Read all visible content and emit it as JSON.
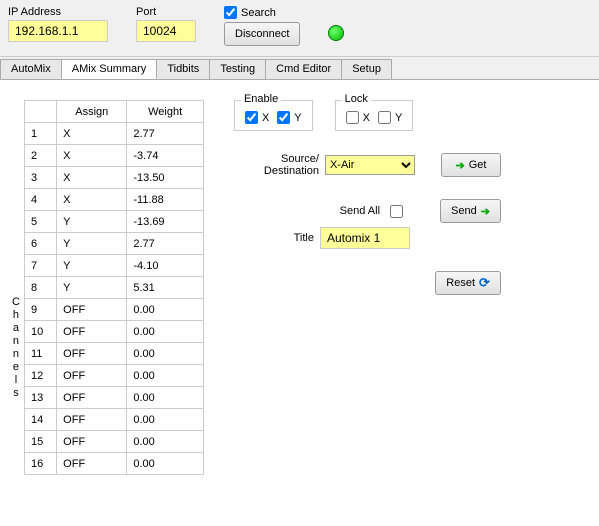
{
  "top": {
    "ip_label": "IP Address",
    "ip_value": "192.168.1.1",
    "port_label": "Port",
    "port_value": "10024",
    "search_label": "Search",
    "search_checked": true,
    "disconnect_label": "Disconnect"
  },
  "tabs": {
    "items": [
      "AutoMix",
      "AMix Summary",
      "Tidbits",
      "Testing",
      "Cmd Editor",
      "Setup"
    ],
    "active_index": 1
  },
  "channels": {
    "vlabel": "Channels",
    "headers": {
      "assign": "Assign",
      "weight": "Weight"
    },
    "rows": [
      {
        "idx": "1",
        "assign": "X",
        "weight": "2.77"
      },
      {
        "idx": "2",
        "assign": "X",
        "weight": "-3.74"
      },
      {
        "idx": "3",
        "assign": "X",
        "weight": "-13.50"
      },
      {
        "idx": "4",
        "assign": "X",
        "weight": "-11.88"
      },
      {
        "idx": "5",
        "assign": "Y",
        "weight": "-13.69"
      },
      {
        "idx": "6",
        "assign": "Y",
        "weight": "2.77"
      },
      {
        "idx": "7",
        "assign": "Y",
        "weight": "-4.10"
      },
      {
        "idx": "8",
        "assign": "Y",
        "weight": "5.31"
      },
      {
        "idx": "9",
        "assign": "OFF",
        "weight": "0.00"
      },
      {
        "idx": "10",
        "assign": "OFF",
        "weight": "0.00"
      },
      {
        "idx": "11",
        "assign": "OFF",
        "weight": "0.00"
      },
      {
        "idx": "12",
        "assign": "OFF",
        "weight": "0.00"
      },
      {
        "idx": "13",
        "assign": "OFF",
        "weight": "0.00"
      },
      {
        "idx": "14",
        "assign": "OFF",
        "weight": "0.00"
      },
      {
        "idx": "15",
        "assign": "OFF",
        "weight": "0.00"
      },
      {
        "idx": "16",
        "assign": "OFF",
        "weight": "0.00"
      }
    ]
  },
  "right": {
    "enable": {
      "legend": "Enable",
      "x_label": "X",
      "y_label": "Y",
      "x_checked": true,
      "y_checked": true
    },
    "lock": {
      "legend": "Lock",
      "x_label": "X",
      "y_label": "Y",
      "x_checked": false,
      "y_checked": false
    },
    "source_label_1": "Source/",
    "source_label_2": "Destination",
    "source_value": "X-Air",
    "get_label": "Get",
    "sendall_label": "Send All",
    "sendall_checked": false,
    "send_label": "Send",
    "title_label": "Title",
    "title_value": "Automix 1",
    "reset_label": "Reset"
  }
}
